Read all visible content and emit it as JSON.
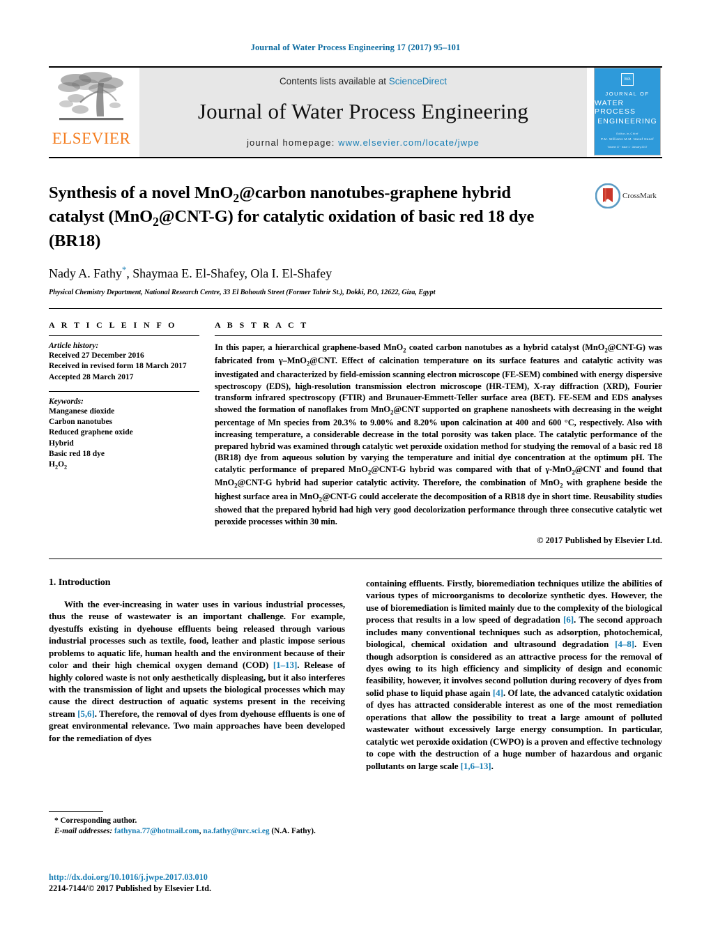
{
  "running_head": "Journal of Water Process Engineering 17 (2017) 95–101",
  "masthead": {
    "publisher_word": "ELSEVIER",
    "contents_prefix": "Contents lists available at ",
    "contents_link": "ScienceDirect",
    "journal_name": "Journal of Water Process Engineering",
    "homepage_prefix": "journal homepage: ",
    "homepage_url": "www.elsevier.com/locate/jwpe",
    "cover": {
      "line1": "JOURNAL OF",
      "line2": "WATER PROCESS",
      "line3": "ENGINEERING",
      "editors_label": "Editor-in-Chief",
      "editors": "P.M. Williams    M.M. Nasef Nasef",
      "footer": "Volume 17 · Issue 1 · January 2017",
      "color": "#2e9ada"
    }
  },
  "article": {
    "title_line1": "Synthesis of a novel MnO2@carbon nanotubes-graphene hybrid",
    "title_line2": "catalyst (MnO2@CNT-G) for catalytic oxidation of basic red 18 dye",
    "title_line3": "(BR18)",
    "authors": "Nady A. Fathy, Shaymaa E. El-Shafey, Ola I. El-Shafey",
    "corresponding_marker": "*",
    "affiliation": "Physical Chemistry Department, National Research Centre, 33 El Bohouth Street (Former Tahrir St.), Dokki, P.O, 12622, Giza, Egypt",
    "crossmark_label": "CrossMark"
  },
  "article_info": {
    "kicker": "A R T I C L E   I N F O",
    "history_label": "Article history:",
    "history": [
      "Received 27 December 2016",
      "Received in revised form 18 March 2017",
      "Accepted 28 March 2017"
    ],
    "keywords_label": "Keywords:",
    "keywords": [
      "Manganese dioxide",
      "Carbon nanotubes",
      "Reduced graphene oxide",
      "Hybrid",
      "Basic red 18 dye",
      "H2O2"
    ]
  },
  "abstract": {
    "kicker": "A B S T R A C T",
    "text": "In this paper, a hierarchical graphene-based MnO2 coated carbon nanotubes as a hybrid catalyst (MnO2@CNT-G) was fabricated from γ–MnO2@CNT. Effect of calcination temperature on its surface features and catalytic activity was investigated and characterized by field-emission scanning electron microscope (FE-SEM) combined with energy dispersive spectroscopy (EDS), high-resolution transmission electron microscope (HR-TEM), X-ray diffraction (XRD), Fourier transform infrared spectroscopy (FTIR) and Brunauer-Emmett-Teller surface area (BET). FE-SEM and EDS analyses showed the formation of nanoflakes from MnO2@CNT supported on graphene nanosheets with decreasing in the weight percentage of Mn species from 20.3% to 9.00% and 8.20% upon calcination at 400 and 600 °C, respectively. Also with increasing temperature, a considerable decrease in the total porosity was taken place. The catalytic performance of the prepared hybrid was examined through catalytic wet peroxide oxidation method for studying the removal of a basic red 18 (BR18) dye from aqueous solution by varying the temperature and initial dye concentration at the optimum pH. The catalytic performance of prepared MnO2@CNT-G hybrid was compared with that of γ-MnO2@CNT and found that MnO2@CNT-G hybrid had superior catalytic activity. Therefore, the combination of MnO2 with graphene beside the highest surface area in MnO2@CNT-G could accelerate the decomposition of a RB18 dye in short time. Reusability studies showed that the prepared hybrid had high very good decolorization performance through three consecutive catalytic wet peroxide processes within 30 min.",
    "copyright": "© 2017 Published by Elsevier Ltd."
  },
  "introduction": {
    "heading": "1.  Introduction",
    "left_paragraph": "With the ever-increasing in water uses in various industrial processes, thus the reuse of wastewater is an important challenge. For example, dyestuffs existing in dyehouse effluents being released through various industrial processes such as textile, food, leather and plastic impose serious problems to aquatic life, human health and the environment because of their color and their high chemical oxygen demand (COD) [1–13]. Release of highly colored waste is not only aesthetically displeasing, but it also interferes with the transmission of light and upsets the biological processes which may cause the direct destruction of aquatic systems present in the receiving stream [5,6]. Therefore, the removal of dyes from dyehouse effluents is one of great environmental relevance. Two main approaches have been developed for the remediation of dyes",
    "right_paragraph": "containing effluents. Firstly, bioremediation techniques utilize the abilities of various types of microorganisms to decolorize synthetic dyes. However, the use of bioremediation is limited mainly due to the complexity of the biological process that results in a low speed of degradation [6]. The second approach includes many conventional techniques such as adsorption, photochemical, biological, chemical oxidation and ultrasound degradation [4–8]. Even though adsorption is considered as an attractive process for the removal of dyes owing to its high efficiency and simplicity of design and economic feasibility, however, it involves second pollution during recovery of dyes from solid phase to liquid phase again [4]. Of late, the advanced catalytic oxidation of dyes has attracted considerable interest as one of the most remediation operations that allow the possibility to treat a large amount of polluted wastewater without excessively large energy consumption. In particular, catalytic wet peroxide oxidation (CWPO) is a proven and effective technology to cope with the destruction of a huge number of hazardous and organic pollutants on large scale [1,6–13]."
  },
  "footnote": {
    "corresponding": "* Corresponding author.",
    "email_label": "E-mail addresses:",
    "email1": "fathyna.77@hotmail.com",
    "email_sep": ", ",
    "email2": "na.fathy@nrc.sci.eg",
    "email_suffix": " (N.A. Fathy)."
  },
  "footer": {
    "doi": "http://dx.doi.org/10.1016/j.jwpe.2017.03.010",
    "issn": "2214-7144/© 2017 Published by Elsevier Ltd."
  },
  "colors": {
    "link": "#1a7fb5",
    "running_head": "#0b6ba0",
    "elsevier_orange": "#f47d20",
    "cover_blue": "#2e9ada"
  }
}
